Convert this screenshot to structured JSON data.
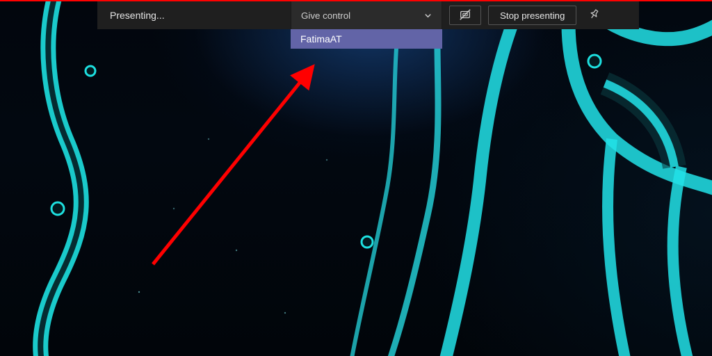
{
  "toolbar": {
    "status_label": "Presenting...",
    "give_control_label": "Give control",
    "stop_label": "Stop presenting"
  },
  "dropdown": {
    "selected_participant": "FatimaAT"
  },
  "colors": {
    "accent": "#6264a7",
    "toolbar_bg": "#1f1f1f",
    "annotation": "#ff0000"
  }
}
